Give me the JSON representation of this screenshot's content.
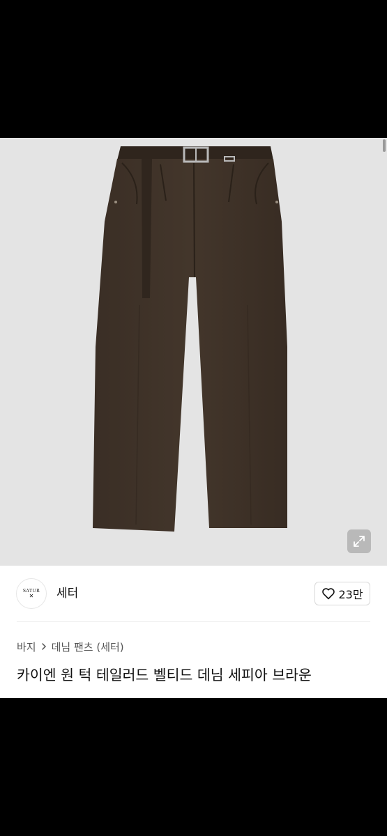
{
  "seller": {
    "avatar_text": "SATUR",
    "name": "세터"
  },
  "like": {
    "icon": "heart-outline-icon",
    "count": "23만"
  },
  "breadcrumb": {
    "category": "바지",
    "separator_icon": "chevron-right-icon",
    "subcategory": "데님 팬츠 (세터)"
  },
  "product": {
    "title": "카이엔 원 턱 테일러드 벨티드 데님 세피아 브라운",
    "image_subject": "brown-belted-denim-pants",
    "image_background": "#e4e4e4",
    "garment_color": "#3d3128"
  },
  "image_controls": {
    "expand_icon": "expand-arrows-icon"
  }
}
